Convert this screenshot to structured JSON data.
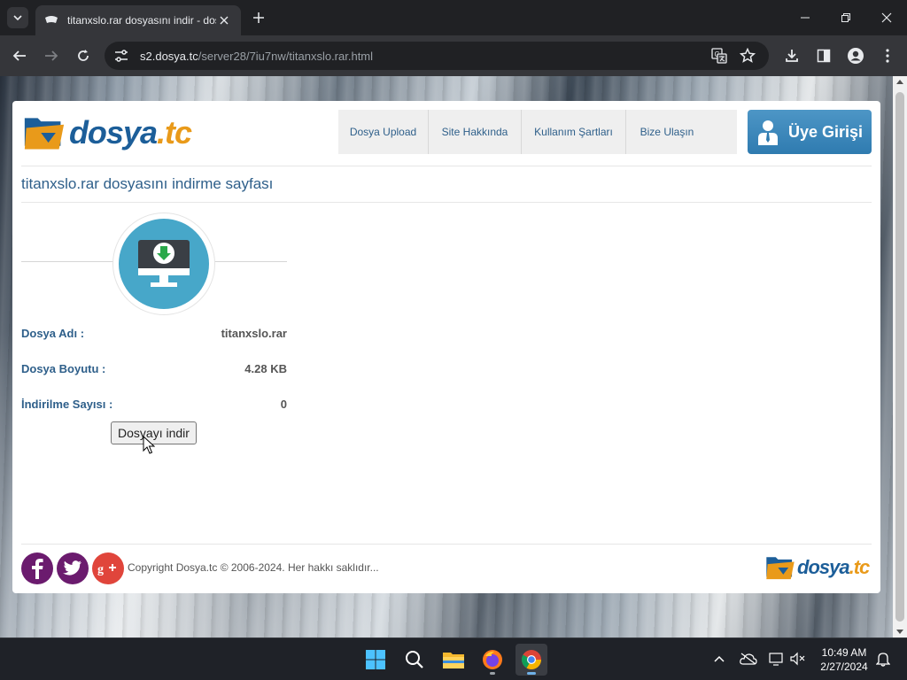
{
  "browser": {
    "tab_title": "titanxslo.rar dosyasını indir - dosya.tc",
    "url_host": "s2.dosya.tc",
    "url_path": "/server28/7iu7nw/titanxslo.rar.html"
  },
  "site": {
    "logo_main": "dosya",
    "logo_tld": ".tc",
    "nav": [
      "Dosya Upload",
      "Site Hakkında",
      "Kullanım Şartları",
      "Bize Ulaşın"
    ],
    "login_label": "Üye Girişi",
    "heading": "titanxslo.rar dosyasını indirme sayfası",
    "file_info": [
      {
        "label": "Dosya Adı :",
        "value": "titanxslo.rar"
      },
      {
        "label": "Dosya Boyutu :",
        "value": "4.28 KB"
      },
      {
        "label": "İndirilme Sayısı :",
        "value": "0"
      }
    ],
    "download_button": "Dosyayı indir",
    "social": [
      "facebook-icon",
      "twitter-icon",
      "google-plus-icon"
    ],
    "copyright": "Copyright Dosya.tc © 2006-2024. Her hakkı saklıdır..."
  },
  "taskbar": {
    "time": "10:49 AM",
    "date": "2/27/2024"
  },
  "colors": {
    "brand_blue": "#1c5e99",
    "brand_orange": "#e99a1a",
    "link_blue": "#2e5f8a",
    "hero_circle": "#47a7c9"
  }
}
